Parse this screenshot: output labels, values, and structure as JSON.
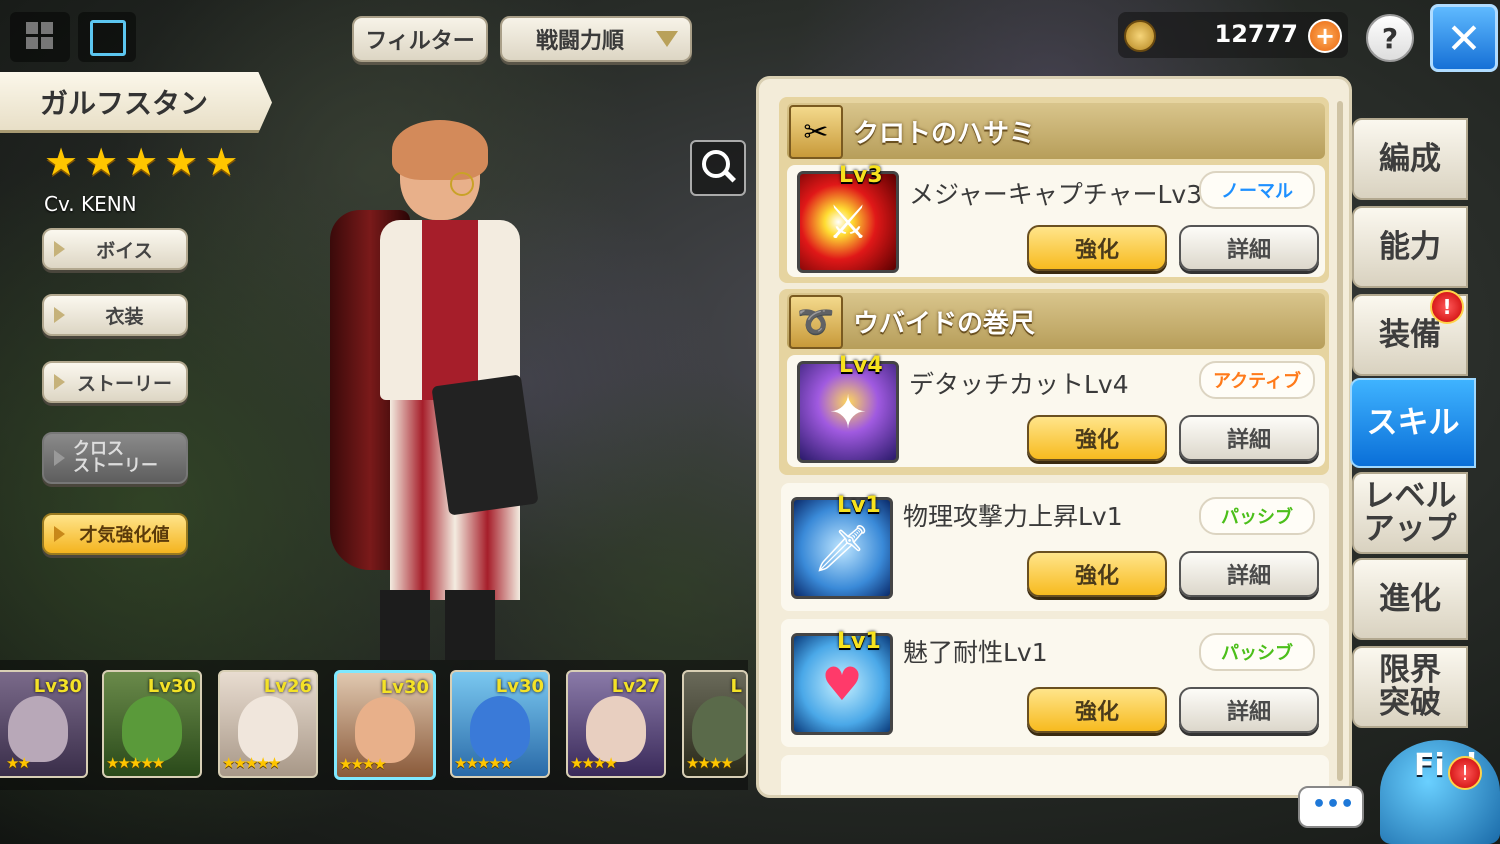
{
  "header": {
    "filter_label": "フィルター",
    "sort_label": "戦闘力順",
    "currency_value": "12777",
    "help_label": "?",
    "close_label": "✕"
  },
  "character": {
    "name": "ガルフスタン",
    "stars": 5,
    "star_glyph": "★",
    "cv": "Cv. KENN"
  },
  "side_menu": [
    {
      "label": "ボイス"
    },
    {
      "label": "衣装"
    },
    {
      "label": "ストーリー"
    },
    {
      "label": "クロス\nストーリー"
    },
    {
      "label": "才気強化値"
    }
  ],
  "tabs": [
    {
      "label": "編成"
    },
    {
      "label": "能力"
    },
    {
      "label": "装備",
      "alert": "!"
    },
    {
      "label": "スキル"
    },
    {
      "label": "レベル\nアップ"
    },
    {
      "label": "進化"
    },
    {
      "label": "限界\n突破"
    }
  ],
  "skills": {
    "group1_title": "クロトのハサミ",
    "group2_title": "ウバイドの巻尺",
    "enhance_label": "強化",
    "detail_label": "詳細",
    "items": [
      {
        "lv": "Lv3",
        "name": "メジャーキャプチャーLv3",
        "type": "ノーマル",
        "type_color": "#1e90ff"
      },
      {
        "lv": "Lv4",
        "name": "デタッチカットLv4",
        "type": "アクティブ",
        "type_color": "#ff7a1a"
      },
      {
        "lv": "Lv1",
        "name": "物理攻撃力上昇Lv1",
        "type": "パッシブ",
        "type_color": "#4cbf1a"
      },
      {
        "lv": "Lv1",
        "name": "魅了耐性Lv1",
        "type": "パッシブ",
        "type_color": "#4cbf1a"
      }
    ]
  },
  "roster": [
    {
      "lv": "Lv30",
      "stars": "★★"
    },
    {
      "lv": "Lv30",
      "stars": "★★★★★"
    },
    {
      "lv": "Lv26",
      "stars": "★★★★★"
    },
    {
      "lv": "Lv30",
      "stars": "★★★★"
    },
    {
      "lv": "Lv30",
      "stars": "★★★★★"
    },
    {
      "lv": "Lv27",
      "stars": "★★★★"
    },
    {
      "lv": "L",
      "stars": "★★★★"
    }
  ],
  "chat": {
    "label": "•••"
  },
  "alert_badge": "!",
  "fid_label": "Fi d"
}
